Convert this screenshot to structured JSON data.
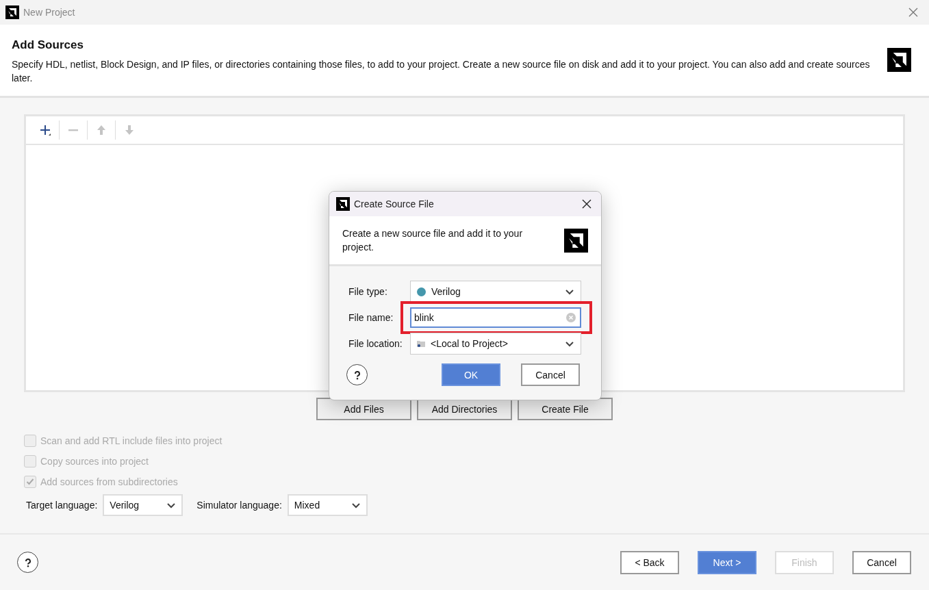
{
  "window": {
    "title": "New Project"
  },
  "header": {
    "title": "Add Sources",
    "description": "Specify HDL, netlist, Block Design, and IP files, or directories containing those files, to add to your project. Create a new source file on disk and add it to your project. You can also add and create sources later."
  },
  "toolbar": [
    {
      "kind": "add",
      "disabled": false
    },
    {
      "kind": "remove",
      "disabled": true
    },
    {
      "kind": "up",
      "disabled": true
    },
    {
      "kind": "down",
      "disabled": true
    }
  ],
  "file_actions": [
    {
      "label": "Add Files"
    },
    {
      "label": "Add Directories"
    },
    {
      "label": "Create File"
    }
  ],
  "options": [
    {
      "label": "Scan and add RTL include files into project",
      "checked": false,
      "disabled": true
    },
    {
      "label": "Copy sources into project",
      "checked": false,
      "disabled": true
    },
    {
      "label": "Add sources from subdirectories",
      "checked": true,
      "disabled": true
    }
  ],
  "languages": [
    {
      "label": "Target language:",
      "value": "Verilog"
    },
    {
      "label": "Simulator language:",
      "value": "Mixed"
    }
  ],
  "buttons": [
    {
      "label": "< Back",
      "kind": "default",
      "disabled": false
    },
    {
      "label": "Next >",
      "kind": "primary",
      "disabled": false
    },
    {
      "label": "Finish",
      "kind": "default",
      "disabled": true
    },
    {
      "label": "Cancel",
      "kind": "default",
      "disabled": false
    }
  ],
  "dialog": {
    "title": "Create Source File",
    "description": "Create a new source file and add it to your project.",
    "fields": [
      {
        "kind": "type_select",
        "label": "File type:",
        "value": "Verilog",
        "highlighted": false
      },
      {
        "kind": "text",
        "label": "File name:",
        "value": "blink",
        "highlighted": true
      },
      {
        "kind": "location_select",
        "label": "File location:",
        "value": "<Local to Project>",
        "highlighted": false
      }
    ],
    "buttons": [
      {
        "label": "OK",
        "kind": "primary"
      },
      {
        "label": "Cancel",
        "kind": "default"
      }
    ]
  }
}
